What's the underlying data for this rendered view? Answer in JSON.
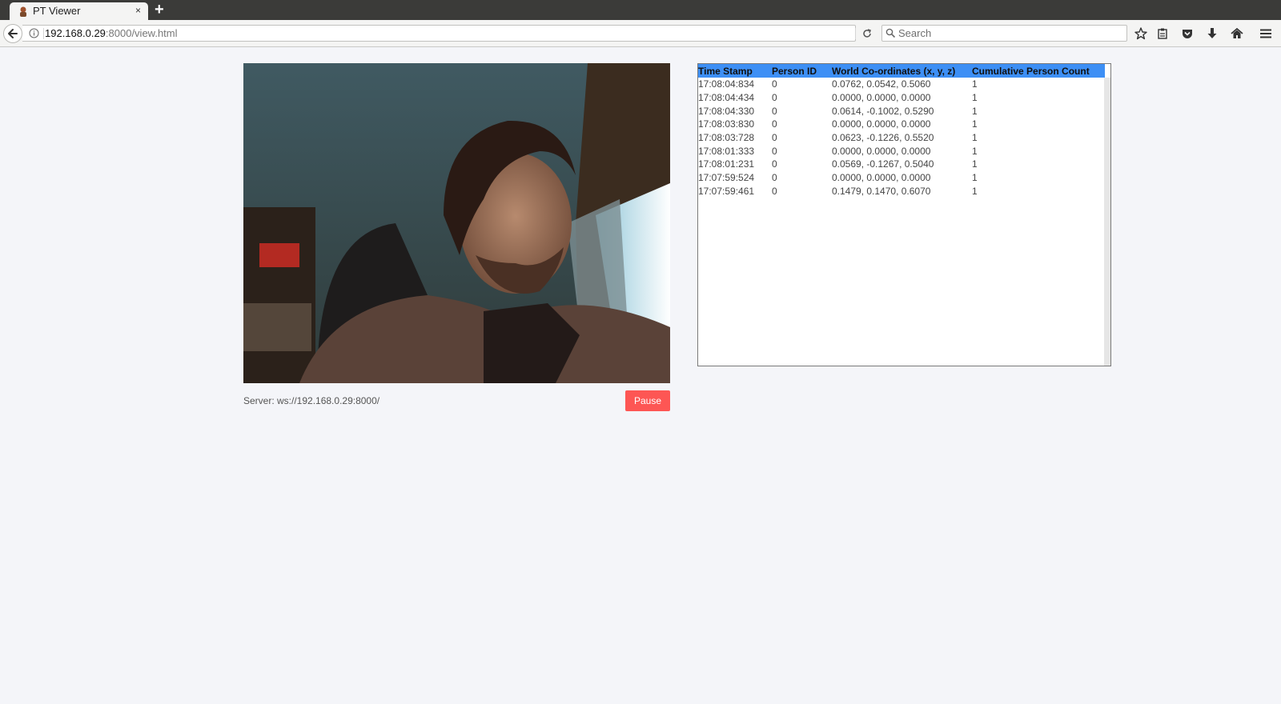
{
  "browser": {
    "tab_title": "PT Viewer",
    "tab_close": "×",
    "new_tab": "+",
    "url_host": "192.168.0.29",
    "url_path": ":8000/view.html",
    "search_placeholder": "Search"
  },
  "page": {
    "server_text": "Server: ws://192.168.0.29:8000/",
    "pause_label": "Pause",
    "video_description": "webcam-frame-person"
  },
  "table": {
    "headers": [
      "Time Stamp",
      "Person ID",
      "World Co-ordinates (x, y, z)",
      "Cumulative Person Count"
    ],
    "rows": [
      [
        "17:08:04:834",
        "0",
        "0.0762, 0.0542, 0.5060",
        "1"
      ],
      [
        "17:08:04:434",
        "0",
        "0.0000, 0.0000, 0.0000",
        "1"
      ],
      [
        "17:08:04:330",
        "0",
        "0.0614, -0.1002, 0.5290",
        "1"
      ],
      [
        "17:08:03:830",
        "0",
        "0.0000, 0.0000, 0.0000",
        "1"
      ],
      [
        "17:08:03:728",
        "0",
        "0.0623, -0.1226, 0.5520",
        "1"
      ],
      [
        "17:08:01:333",
        "0",
        "0.0000, 0.0000, 0.0000",
        "1"
      ],
      [
        "17:08:01:231",
        "0",
        "0.0569, -0.1267, 0.5040",
        "1"
      ],
      [
        "17:07:59:524",
        "0",
        "0.0000, 0.0000, 0.0000",
        "1"
      ],
      [
        "17:07:59:461",
        "0",
        "0.1479, 0.1470, 0.6070",
        "1"
      ]
    ]
  },
  "colors": {
    "header_bg": "#3d8ff5",
    "pause_bg": "#fd5654",
    "page_bg": "#f4f5f9"
  },
  "icons": [
    "back-arrow-icon",
    "info-icon",
    "reload-icon",
    "search-icon",
    "bookmark-star-icon",
    "reading-list-icon",
    "pocket-icon",
    "download-icon",
    "home-icon",
    "menu-icon"
  ]
}
